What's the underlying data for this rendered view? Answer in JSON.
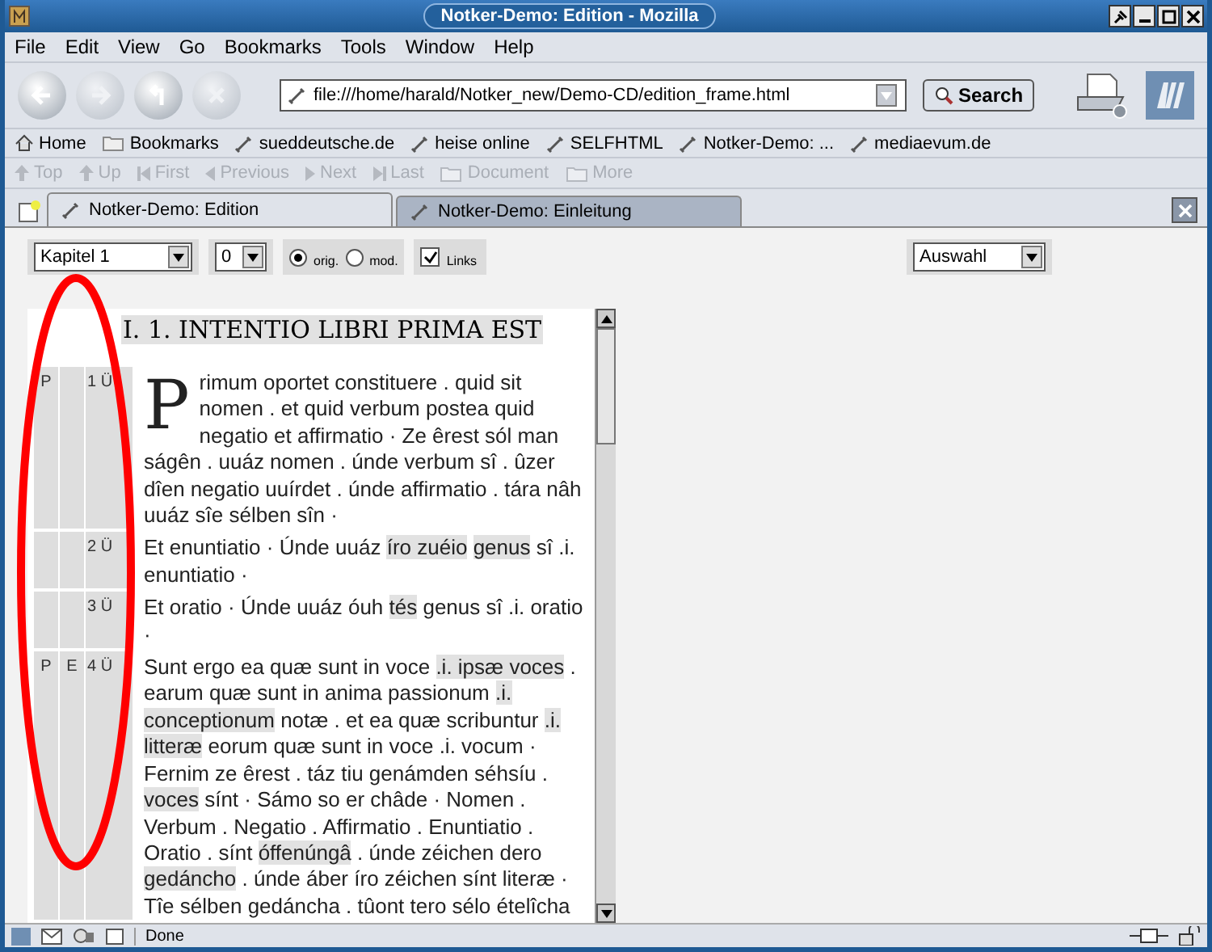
{
  "window": {
    "title": "Notker-Demo: Edition - Mozilla"
  },
  "menu": [
    "File",
    "Edit",
    "View",
    "Go",
    "Bookmarks",
    "Tools",
    "Window",
    "Help"
  ],
  "navigation": {
    "url": "file:///home/harald/Notker_new/Demo-CD/edition_frame.html",
    "search_button": "Search"
  },
  "bookmarks": [
    {
      "label": "Home",
      "kind": "home"
    },
    {
      "label": "Bookmarks",
      "kind": "folder"
    },
    {
      "label": "sueddeutsche.de",
      "kind": "link"
    },
    {
      "label": "heise online",
      "kind": "link"
    },
    {
      "label": "SELFHTML",
      "kind": "link"
    },
    {
      "label": "Notker-Demo: ...",
      "kind": "link"
    },
    {
      "label": "mediaevum.de",
      "kind": "link"
    }
  ],
  "link_toolbar": [
    {
      "label": "Top",
      "kind": "up"
    },
    {
      "label": "Up",
      "kind": "up"
    },
    {
      "label": "First",
      "kind": "first"
    },
    {
      "label": "Previous",
      "kind": "prev"
    },
    {
      "label": "Next",
      "kind": "next"
    },
    {
      "label": "Last",
      "kind": "last"
    },
    {
      "label": "Document",
      "kind": "folder"
    },
    {
      "label": "More",
      "kind": "folder"
    }
  ],
  "tabs": [
    {
      "label": "Notker-Demo: Edition",
      "selected": true
    },
    {
      "label": "Notker-Demo: Einleitung",
      "selected": false
    }
  ],
  "controls": {
    "chapter_select": "Kapitel 1",
    "number_select": "0",
    "radios": [
      {
        "label": "orig.",
        "selected": true
      },
      {
        "label": "mod.",
        "selected": false
      }
    ],
    "links_checkbox": {
      "label": "Links",
      "checked": true
    },
    "choice_select": "Auswahl"
  },
  "document": {
    "heading": "I. 1. INTENTIO LIBRI PRIMA EST",
    "paragraphs": [
      {
        "col_1": "P",
        "col_3": "1 Ü",
        "drop_cap": "P",
        "segments": [
          {
            "text": "rimum oportet constituere . quid sit nomen . et quid verbum  postea quid negatio et affirmatio · Ze êrest sól man ságên . uuáz nomen . únde verbum sî . ûzer dîen negatio uuírdet . únde affirmatio . tára nâh uuáz sîe sélben sîn ·",
            "highlighted": false
          }
        ]
      },
      {
        "col_3": "2 Ü",
        "segments": [
          {
            "text": "Et enuntiatio · Únde uuáz ",
            "highlighted": false
          },
          {
            "text": "íro zuéio",
            "highlighted": true
          },
          {
            "text": "genus",
            "highlighted": true
          },
          {
            "text": " sî .i. enuntiatio ·",
            "highlighted": false
          }
        ]
      },
      {
        "col_3": "3 Ü",
        "segments": [
          {
            "text": "Et oratio · Únde uuáz óuh ",
            "highlighted": false
          },
          {
            "text": "tés",
            "highlighted": true
          },
          {
            "text": " genus sî .i. oratio ·",
            "highlighted": false
          }
        ]
      },
      {
        "col_1": "P",
        "col_2": "E",
        "col_3": "4 Ü",
        "segments": [
          {
            "text": "Sunt ergo ea quæ sunt in voce ",
            "highlighted": false
          },
          {
            "text": ".i. ipsæ voces",
            "highlighted": true
          },
          {
            "text": " . earum quæ sunt in anima passionum ",
            "highlighted": false
          },
          {
            "text": ".i. conceptionum",
            "highlighted": true
          },
          {
            "text": " notæ . et ea quæ scribuntur ",
            "highlighted": false
          },
          {
            "text": ".i. litteræ",
            "highlighted": true
          },
          {
            "text": " eorum quæ sunt in voce  .i. vocum  · Fernim ze êrest . táz tiu genámden séhsíu . ",
            "highlighted": false
          },
          {
            "text": "voces",
            "highlighted": true
          },
          {
            "text": " sínt · Sámo so er châde · Nomen . Verbum . Negatio . Affirmatio . Enuntiatio . Oratio . sínt ",
            "highlighted": false
          },
          {
            "text": "óffenúngâ",
            "highlighted": true
          },
          {
            "text": " . únde zéichen dero ",
            "highlighted": false
          },
          {
            "text": "gedáncho",
            "highlighted": true
          },
          {
            "text": " . únde áber íro zéichen sínt literæ · Tîe sélben gedáncha . tûont tero sélo ételîcha",
            "highlighted": false
          }
        ]
      }
    ]
  },
  "status_bar": {
    "text": "Done"
  }
}
